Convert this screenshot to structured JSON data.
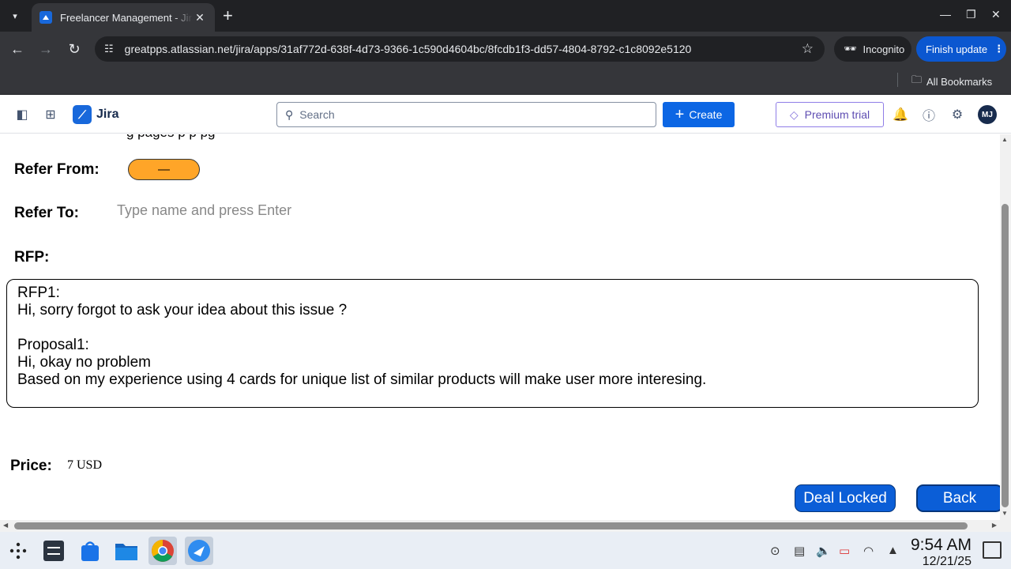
{
  "browser": {
    "tab_title": "Freelancer Management - Jira",
    "url": "greatpps.atlassian.net/jira/apps/31af772d-638f-4d73-9366-1c590d4604bc/8fcdb1f3-dd57-4804-8792-c1c8092e5120",
    "incognito_label": "Incognito",
    "finish_update_label": "Finish update",
    "all_bookmarks_label": "All Bookmarks"
  },
  "jira": {
    "app_name": "Jira",
    "search_placeholder": "Search",
    "create_label": "Create",
    "premium_label": "Premium trial",
    "avatar_initials": "MJ"
  },
  "form": {
    "cut_off_text": "g pages                                      p                    p                            pg",
    "refer_from_label": "Refer From:",
    "refer_from_value": "—",
    "refer_to_label": "Refer To:",
    "refer_to_placeholder": "Type name and press Enter",
    "rfp_label": "RFP:",
    "rfp_lines": [
      "RFP1:",
      "Hi, sorry forgot to ask your idea about this issue ?",
      "",
      "Proposal1:",
      "Hi, okay no problem",
      "Based on my experience using 4 cards for unique list of similar products will make user more interesing."
    ],
    "price_label": "Price:",
    "price_value": "7 USD",
    "deal_locked_label": "Deal Locked",
    "back_label": "Back"
  },
  "taskbar": {
    "time": "9:54 AM",
    "date": "12/21/25"
  },
  "colors": {
    "accent": "#0c66e4",
    "refer_pill": "#ffa528",
    "action_button": "#0b5ed7"
  }
}
